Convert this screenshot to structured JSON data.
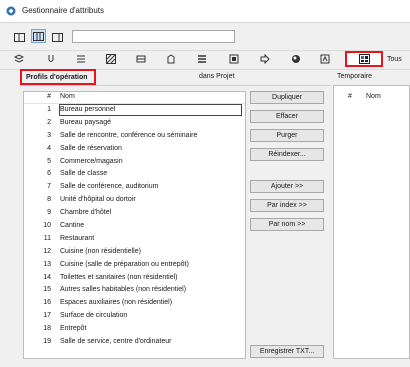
{
  "window": {
    "title": "Gestionnaire d'attributs"
  },
  "search": {
    "value": ""
  },
  "tabs": {
    "selected_label": "Tous"
  },
  "left_panel": {
    "heading": "Profils d'opération",
    "subheading": "dans Projet"
  },
  "right_panel": {
    "heading": "Temporaire"
  },
  "list": {
    "columns": [
      "#",
      "Nom"
    ],
    "rows": [
      {
        "num": "1",
        "name": "Bureau personnel"
      },
      {
        "num": "2",
        "name": "Bureau paysagé"
      },
      {
        "num": "3",
        "name": "Salle de rencontre, conférence ou séminaire"
      },
      {
        "num": "4",
        "name": "Salle de réservation"
      },
      {
        "num": "5",
        "name": "Commerce/magasin"
      },
      {
        "num": "6",
        "name": "Salle de classe"
      },
      {
        "num": "7",
        "name": "Salle de conférence, auditorium"
      },
      {
        "num": "8",
        "name": "Unité d'hôpital ou dortoir"
      },
      {
        "num": "9",
        "name": "Chambre d'hôtel"
      },
      {
        "num": "10",
        "name": "Cantine"
      },
      {
        "num": "11",
        "name": "Restaurant"
      },
      {
        "num": "12",
        "name": "Cuisine (non résidentielle)"
      },
      {
        "num": "13",
        "name": "Cuisine (salle de préparation ou entrepôt)"
      },
      {
        "num": "14",
        "name": "Toilettes et sanitaires (non résidentiel)"
      },
      {
        "num": "15",
        "name": "Autres salles habitables (non résidentiel)"
      },
      {
        "num": "16",
        "name": "Espaces auxiliaires (non résidentiel)"
      },
      {
        "num": "17",
        "name": "Surface de circulation"
      },
      {
        "num": "18",
        "name": "Entrepôt"
      },
      {
        "num": "19",
        "name": "Salle de service, centre d'ordinateur"
      }
    ]
  },
  "buttons": {
    "duplicate": "Dupliquer",
    "delete": "Effacer",
    "purge": "Purger",
    "reindex": "Réindexer...",
    "add": "Ajouter >>",
    "by_index": "Par index >>",
    "by_name": "Par nom >>",
    "save_txt": "Enregistrer TXT..."
  },
  "right_columns": [
    "#",
    "Nom"
  ]
}
